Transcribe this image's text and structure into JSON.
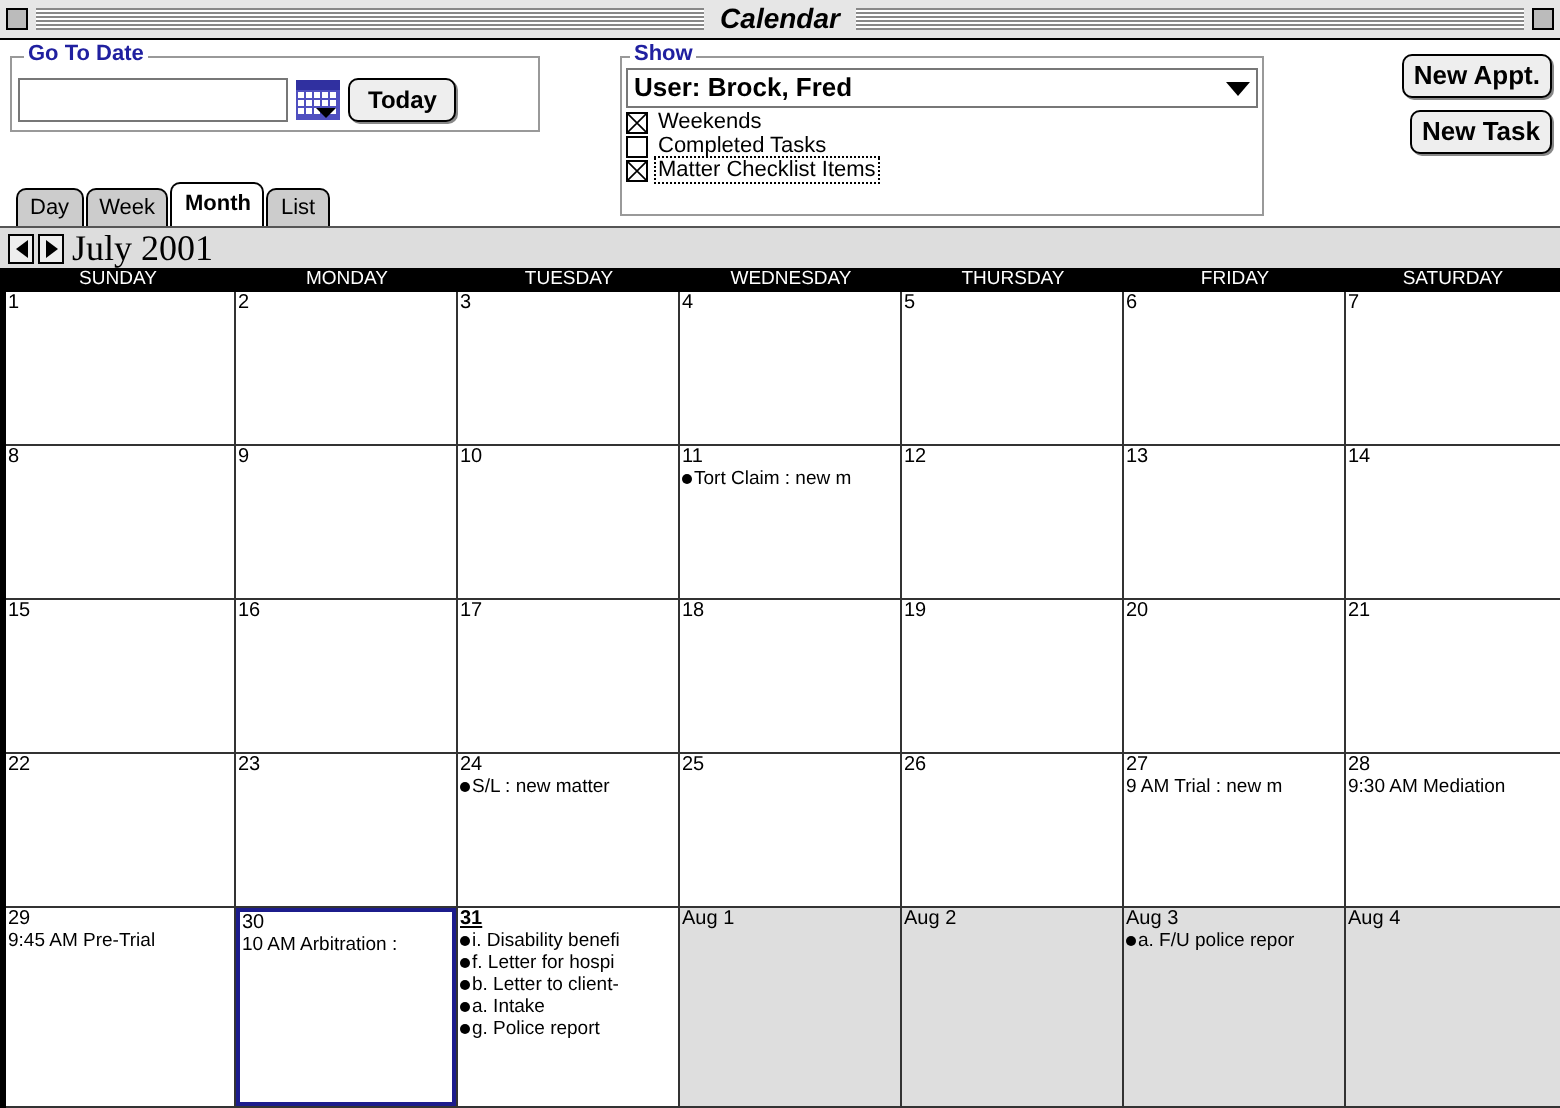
{
  "window": {
    "title": "Calendar"
  },
  "go_to_date": {
    "label": "Go To Date",
    "button": "Today"
  },
  "show": {
    "label": "Show",
    "user": "User: Brock, Fred",
    "options": [
      {
        "label": "Weekends",
        "checked": true,
        "focused": false
      },
      {
        "label": "Completed Tasks",
        "checked": false,
        "focused": false
      },
      {
        "label": "Matter Checklist Items",
        "checked": true,
        "focused": true
      }
    ]
  },
  "buttons": [
    "New Appt.",
    "New Task"
  ],
  "tabs": [
    {
      "label": "Day",
      "selected": false
    },
    {
      "label": "Week",
      "selected": false
    },
    {
      "label": "Month",
      "selected": true
    },
    {
      "label": "List",
      "selected": false
    }
  ],
  "month": "July 2001",
  "weekdays": [
    "SUNDAY",
    "MONDAY",
    "TUESDAY",
    "WEDNESDAY",
    "THURSDAY",
    "FRIDAY",
    "SATURDAY"
  ],
  "weeks": [
    [
      {
        "day": "1",
        "selected": false,
        "today": false,
        "other_month": false
      },
      {
        "day": "2",
        "selected": false,
        "today": false,
        "other_month": false
      },
      {
        "day": "3",
        "selected": false,
        "today": false,
        "other_month": false
      },
      {
        "day": "4",
        "selected": false,
        "today": false,
        "other_month": false
      },
      {
        "day": "5",
        "selected": false,
        "today": false,
        "other_month": false
      },
      {
        "day": "6",
        "selected": false,
        "today": false,
        "other_month": false
      },
      {
        "day": "7",
        "selected": false,
        "today": false,
        "other_month": false
      }
    ],
    [
      {
        "day": "8",
        "selected": false,
        "today": false,
        "other_month": false
      },
      {
        "day": "9",
        "selected": false,
        "today": false,
        "other_month": false
      },
      {
        "day": "10",
        "selected": false,
        "today": false,
        "other_month": false
      },
      {
        "day": "11",
        "selected": false,
        "today": false,
        "other_month": false,
        "events": [
          {
            "kind": "task",
            "text": "Tort Claim : new m"
          }
        ]
      },
      {
        "day": "12",
        "selected": false,
        "today": false,
        "other_month": false
      },
      {
        "day": "13",
        "selected": false,
        "today": false,
        "other_month": false
      },
      {
        "day": "14",
        "selected": false,
        "today": false,
        "other_month": false
      }
    ],
    [
      {
        "day": "15",
        "selected": false,
        "today": false,
        "other_month": false
      },
      {
        "day": "16",
        "selected": false,
        "today": false,
        "other_month": false
      },
      {
        "day": "17",
        "selected": false,
        "today": false,
        "other_month": false
      },
      {
        "day": "18",
        "selected": false,
        "today": false,
        "other_month": false
      },
      {
        "day": "19",
        "selected": false,
        "today": false,
        "other_month": false
      },
      {
        "day": "20",
        "selected": false,
        "today": false,
        "other_month": false
      },
      {
        "day": "21",
        "selected": false,
        "today": false,
        "other_month": false
      }
    ],
    [
      {
        "day": "22",
        "selected": false,
        "today": false,
        "other_month": false
      },
      {
        "day": "23",
        "selected": false,
        "today": false,
        "other_month": false
      },
      {
        "day": "24",
        "selected": false,
        "today": false,
        "other_month": false,
        "events": [
          {
            "kind": "task",
            "text": "S/L : new matter"
          }
        ]
      },
      {
        "day": "25",
        "selected": false,
        "today": false,
        "other_month": false
      },
      {
        "day": "26",
        "selected": false,
        "today": false,
        "other_month": false
      },
      {
        "day": "27",
        "selected": false,
        "today": false,
        "other_month": false,
        "events": [
          {
            "kind": "appointment",
            "text": "9 AM Trial : new m"
          }
        ]
      },
      {
        "day": "28",
        "selected": false,
        "today": false,
        "other_month": false,
        "events": [
          {
            "kind": "appointment",
            "text": "9:30 AM Mediation"
          }
        ]
      }
    ],
    [
      {
        "day": "29",
        "selected": false,
        "today": false,
        "other_month": false,
        "events": [
          {
            "kind": "appointment",
            "text": "9:45 AM Pre-Trial"
          }
        ]
      },
      {
        "day": "30",
        "selected": true,
        "today": false,
        "other_month": false,
        "events": [
          {
            "kind": "appointment",
            "text": "10 AM Arbitration :"
          }
        ]
      },
      {
        "day": "31",
        "selected": false,
        "today": true,
        "other_month": false,
        "events": [
          {
            "kind": "task",
            "text": "i. Disability benefi"
          },
          {
            "kind": "task",
            "text": "f. Letter for hospi"
          },
          {
            "kind": "task",
            "text": "b. Letter to client-"
          },
          {
            "kind": "task",
            "text": "a. Intake"
          },
          {
            "kind": "task",
            "text": "g. Police report"
          }
        ]
      },
      {
        "day": "Aug 1",
        "selected": false,
        "today": false,
        "other_month": true
      },
      {
        "day": "Aug 2",
        "selected": false,
        "today": false,
        "other_month": true
      },
      {
        "day": "Aug 3",
        "selected": false,
        "today": false,
        "other_month": true,
        "events": [
          {
            "kind": "task",
            "text": "a. F/U police repor"
          }
        ]
      },
      {
        "day": "Aug 4",
        "selected": false,
        "today": false,
        "other_month": true
      }
    ]
  ]
}
